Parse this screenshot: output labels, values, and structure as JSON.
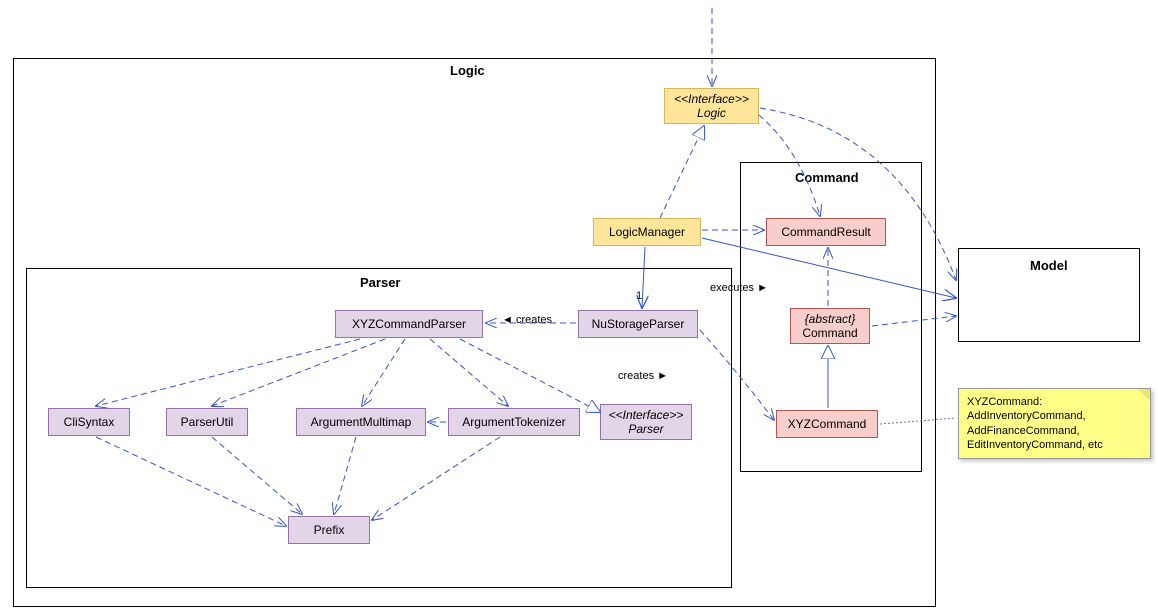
{
  "packages": {
    "logic": "Logic",
    "parser": "Parser",
    "command": "Command",
    "model": "Model"
  },
  "nodes": {
    "logic_if_stereo": "<<Interface>>",
    "logic_if_name": "Logic",
    "logic_manager": "LogicManager",
    "nustorage": "NuStorageParser",
    "xyzparser": "XYZCommandParser",
    "clisyntax": "CliSyntax",
    "parserutil": "ParserUtil",
    "argmultimap": "ArgumentMultimap",
    "argtokenizer": "ArgumentTokenizer",
    "parser_if_stereo": "<<Interface>>",
    "parser_if_name": "Parser",
    "prefix": "Prefix",
    "cmdresult": "CommandResult",
    "abstract_tag": "{abstract}",
    "abstract_name": "Command",
    "xyzcommand": "XYZCommand"
  },
  "edges": {
    "creates1": "◄ creates",
    "creates2": "creates ►",
    "executes": "executes ►",
    "mult_one": "1"
  },
  "note": {
    "l1": "XYZCommand:",
    "l2": "AddInventoryCommand,",
    "l3": "AddFinanceCommand,",
    "l4": "EditInventoryCommand, etc"
  }
}
